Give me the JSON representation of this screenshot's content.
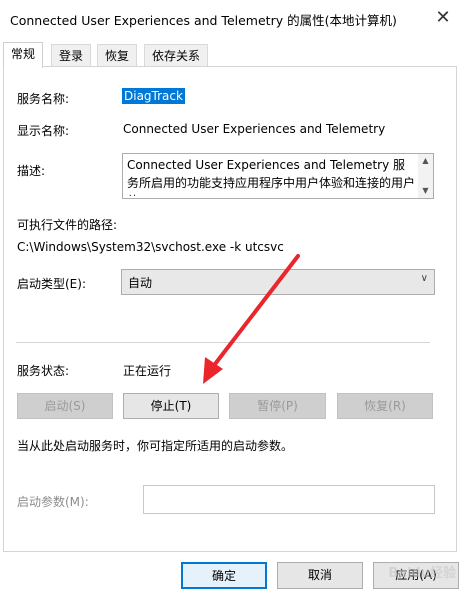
{
  "window": {
    "title": "Connected User Experiences and Telemetry 的属性(本地计算机)"
  },
  "tabs": [
    {
      "label": "常规",
      "active": true
    },
    {
      "label": "登录",
      "active": false
    },
    {
      "label": "恢复",
      "active": false
    },
    {
      "label": "依存关系",
      "active": false
    }
  ],
  "general": {
    "service_name_label": "服务名称:",
    "service_name": "DiagTrack",
    "display_name_label": "显示名称:",
    "display_name": "Connected User Experiences and Telemetry",
    "description_label": "描述:",
    "description": "Connected User Experiences and Telemetry 服务所启用的功能支持应用程序中用户体验和连接的用户体",
    "exe_path_label": "可执行文件的路径:",
    "exe_path": "C:\\Windows\\System32\\svchost.exe -k utcsvc",
    "startup_type_label": "启动类型(E):",
    "startup_type": "自动",
    "status_label": "服务状态:",
    "status": "正在运行",
    "buttons": {
      "start": "启动(S)",
      "stop": "停止(T)",
      "pause": "暂停(P)",
      "resume": "恢复(R)"
    },
    "hint": "当从此处启动服务时，你可指定所适用的启动参数。",
    "start_params_label": "启动参数(M):",
    "start_params_value": ""
  },
  "footer": {
    "ok": "确定",
    "cancel": "取消",
    "apply": "应用(A)"
  },
  "watermark": "Baidu经验",
  "colors": {
    "accent": "#0078d7",
    "annotation_arrow": "#e8262b"
  }
}
